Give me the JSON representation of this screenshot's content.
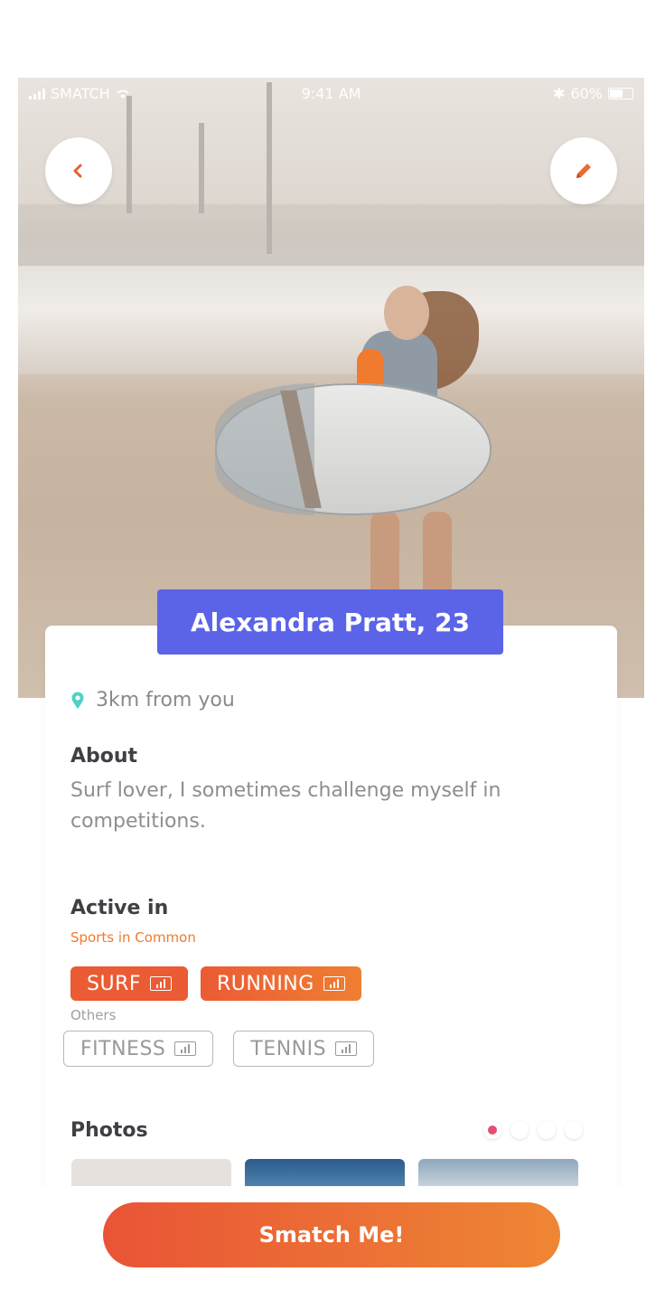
{
  "status_bar": {
    "carrier": "SMATCH",
    "time": "9:41 AM",
    "battery": "60%"
  },
  "icons": {
    "back": "chevron-left-icon",
    "edit": "pencil-icon",
    "location": "location-pin-icon",
    "level": "bar-chart-icon"
  },
  "profile": {
    "name_age": "Alexandra Pratt, 23",
    "distance": "3km from you"
  },
  "about": {
    "title": "About",
    "text": "Surf lover, I sometimes challenge myself in competitions."
  },
  "active_in": {
    "title": "Active in",
    "common_label": "Sports in Common",
    "common": [
      "SURF",
      "RUNNING"
    ],
    "others_label": "Others",
    "others": [
      "FITNESS",
      "TENNIS"
    ]
  },
  "photos": {
    "title": "Photos",
    "pages": 4,
    "active_page": 1
  },
  "cta": {
    "label": "Smatch Me!"
  },
  "colors": {
    "accent_blue": "#5b64e8",
    "accent_orange": "#eb5b34",
    "accent_orange_end": "#ee8634",
    "pin_teal": "#4fd1c5",
    "dot_pink": "#e64d72"
  }
}
